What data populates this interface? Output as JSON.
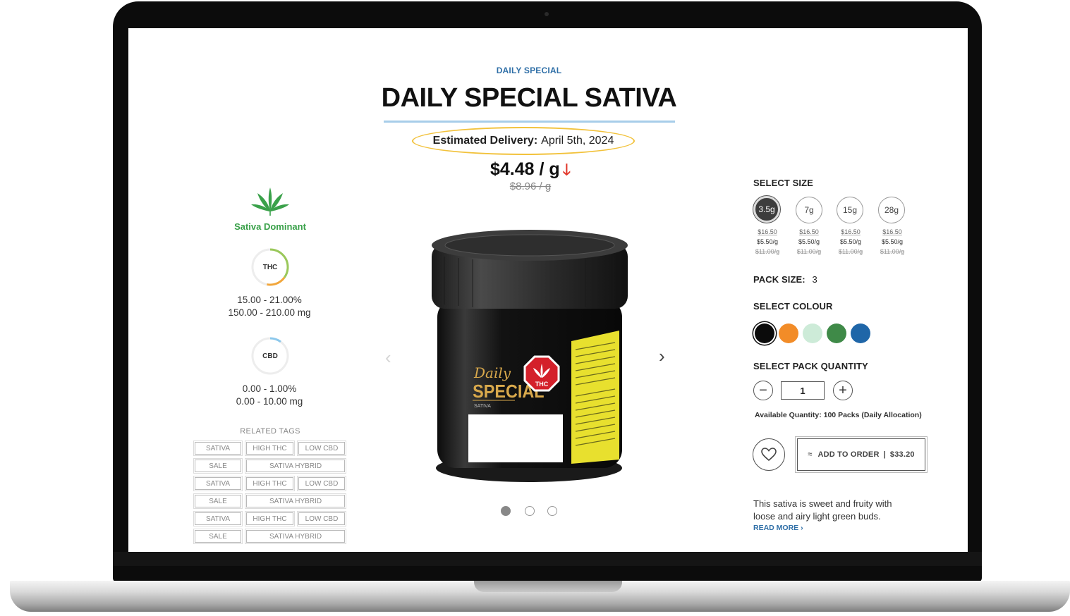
{
  "product": {
    "kicker": "DAILY SPECIAL",
    "title": "DAILY SPECIAL SATIVA",
    "delivery_label": "Estimated Delivery:",
    "delivery_date": "April 5th, 2024",
    "price": "$4.48 / g",
    "old_price": "$8.96 / g",
    "strain_type": "Sativa Dominant",
    "jar_brand_line1": "Daily",
    "jar_brand_line2": "SPECIAL",
    "jar_brand_sub": "SATIVA",
    "jar_badge": "THC"
  },
  "potency": {
    "thc": {
      "label": "THC",
      "percent": "15.00 - 21.00%",
      "mg": "150.00 - 210.00 mg"
    },
    "cbd": {
      "label": "CBD",
      "percent": "0.00 - 1.00%",
      "mg": "0.00 - 10.00 mg"
    }
  },
  "tags": {
    "title": "RELATED TAGS",
    "rows": [
      [
        "SATIVA",
        "HIGH THC",
        "LOW CBD"
      ],
      [
        "SALE",
        "SATIVA HYBRID"
      ],
      [
        "SATIVA",
        "HIGH THC",
        "LOW CBD"
      ],
      [
        "SALE",
        "SATIVA HYBRID"
      ],
      [
        "SATIVA",
        "HIGH THC",
        "LOW CBD"
      ],
      [
        "SALE",
        "SATIVA HYBRID"
      ]
    ]
  },
  "carousel": {
    "slides": 3,
    "active": 1
  },
  "options": {
    "size_label": "SELECT SIZE",
    "sizes": [
      {
        "label": "3.5g",
        "price": "$16.50",
        "per_gram": "$5.50/g",
        "old_per_gram": "$11.00/g",
        "selected": true
      },
      {
        "label": "7g",
        "price": "$16.50",
        "per_gram": "$5.50/g",
        "old_per_gram": "$11.00/g",
        "selected": false
      },
      {
        "label": "15g",
        "price": "$16.50",
        "per_gram": "$5.50/g",
        "old_per_gram": "$11.00/g",
        "selected": false
      },
      {
        "label": "28g",
        "price": "$16.50",
        "per_gram": "$5.50/g",
        "old_per_gram": "$11.00/g",
        "selected": false
      }
    ],
    "pack_size_label": "PACK SIZE:",
    "pack_size_value": "3",
    "colour_label": "SELECT COLOUR",
    "colours": [
      "#0b0b0b",
      "#f28c28",
      "#cdebd8",
      "#3f8a48",
      "#1f66a8"
    ],
    "quantity_label": "SELECT PACK QUANTITY",
    "quantity_value": "1",
    "available": "Available Quantity: 100 Packs (Daily Allocation)",
    "add_to_order": "ADD TO ORDER",
    "order_total": "$33.20",
    "description": "This sativa is sweet and fruity with loose and airy light green buds.",
    "read_more": "READ MORE ›"
  },
  "theme": {
    "accent": "#2f6fa7",
    "highlight": "#f2c23c",
    "strain_green": "#3aa14a",
    "price_down": "#e23a2e"
  }
}
